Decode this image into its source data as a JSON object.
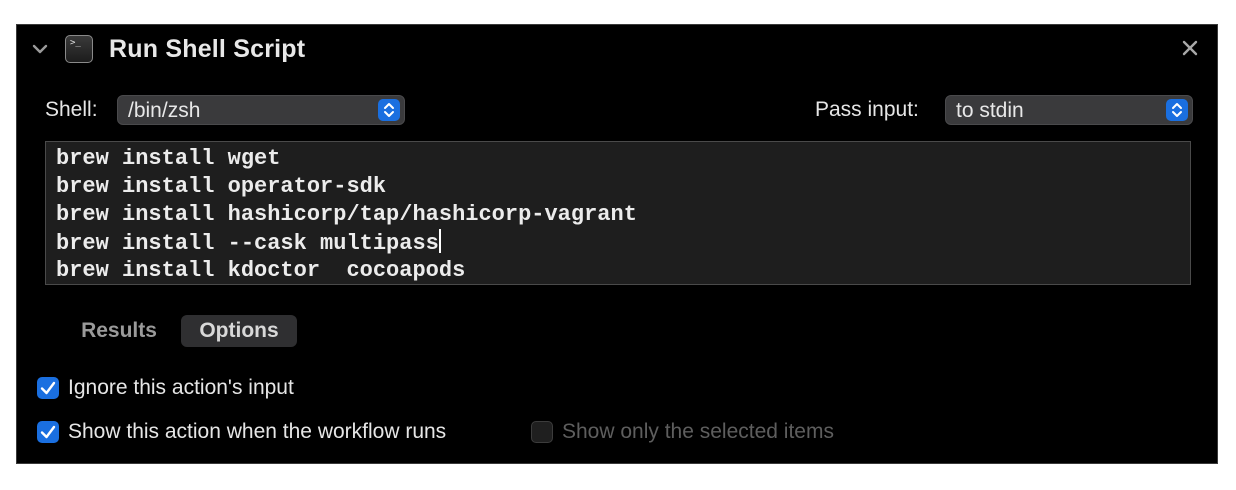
{
  "header": {
    "title": "Run Shell Script",
    "terminal_glyph": ">_",
    "collapse_icon": "chevron-down-icon",
    "close_icon": "close-icon"
  },
  "shell": {
    "label": "Shell:",
    "value": "/bin/zsh"
  },
  "pass_input": {
    "label": "Pass input:",
    "value": "to stdin"
  },
  "script": {
    "lines": [
      "brew install wget",
      "brew install operator-sdk",
      "brew install hashicorp/tap/hashicorp-vagrant",
      "brew install --cask multipass",
      "brew install kdoctor  cocoapods"
    ]
  },
  "tabs": {
    "results": "Results",
    "options": "Options",
    "selected": "Options"
  },
  "options": {
    "ignore_input": {
      "label": "Ignore this action's input",
      "checked": true
    },
    "show_action": {
      "label": "Show this action when the workflow runs",
      "checked": true
    },
    "show_selected": {
      "label": "Show only the selected items",
      "checked": false,
      "enabled": false
    }
  },
  "colors": {
    "accent": "#1a6fe0",
    "panel_background": "#000000",
    "editor_background": "#1e1e1e"
  }
}
